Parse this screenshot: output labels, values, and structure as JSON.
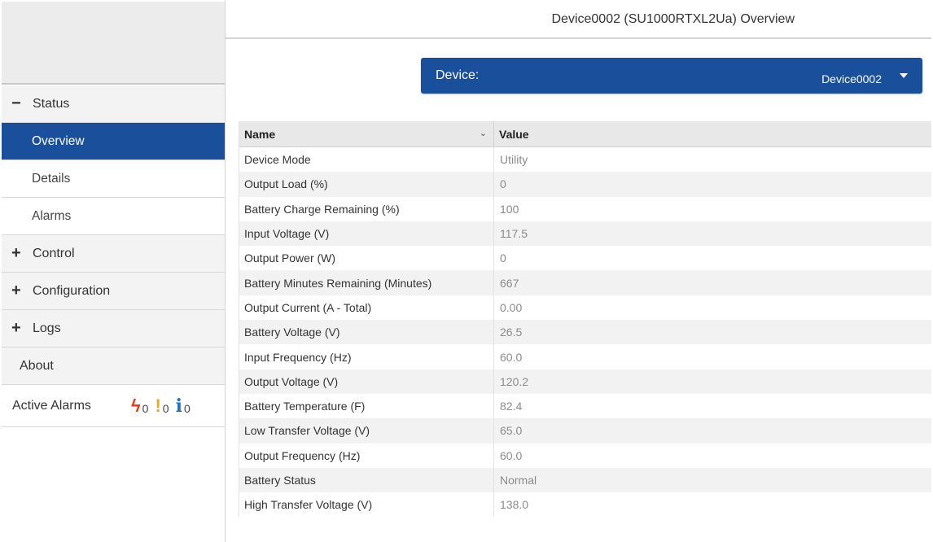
{
  "header": {
    "title": "Device0002 (SU1000RTXL2Ua) Overview"
  },
  "device_select": {
    "label": "Device:",
    "value": "Device0002"
  },
  "sidebar": {
    "status": {
      "sign": "−",
      "label": "Status"
    },
    "status_items": [
      {
        "label": "Overview"
      },
      {
        "label": "Details"
      },
      {
        "label": "Alarms"
      }
    ],
    "control": {
      "sign": "+",
      "label": "Control"
    },
    "configuration": {
      "sign": "+",
      "label": "Configuration"
    },
    "logs": {
      "sign": "+",
      "label": "Logs"
    },
    "about": {
      "label": "About"
    },
    "active_alarms": {
      "label": "Active Alarms",
      "critical_count": "0",
      "warning_count": "0",
      "info_count": "0"
    }
  },
  "table": {
    "columns": {
      "name": "Name",
      "value": "Value"
    },
    "rows": [
      {
        "name": "Device Mode",
        "value": "Utility"
      },
      {
        "name": "Output Load (%)",
        "value": "0"
      },
      {
        "name": "Battery Charge Remaining (%)",
        "value": "100"
      },
      {
        "name": "Input Voltage (V)",
        "value": "117.5"
      },
      {
        "name": "Output Power (W)",
        "value": "0"
      },
      {
        "name": "Battery Minutes Remaining (Minutes)",
        "value": "667"
      },
      {
        "name": "Output Current (A - Total)",
        "value": "0.00"
      },
      {
        "name": "Battery Voltage (V)",
        "value": "26.5"
      },
      {
        "name": "Input Frequency (Hz)",
        "value": "60.0"
      },
      {
        "name": "Output Voltage (V)",
        "value": "120.2"
      },
      {
        "name": "Battery Temperature (F)",
        "value": "82.4"
      },
      {
        "name": "Low Transfer Voltage (V)",
        "value": "65.0"
      },
      {
        "name": "Output Frequency (Hz)",
        "value": "60.0"
      },
      {
        "name": "Battery Status",
        "value": "Normal"
      },
      {
        "name": "High Transfer Voltage (V)",
        "value": "138.0"
      }
    ]
  },
  "icons": {
    "critical": "lightning-bolt-icon",
    "warning": "exclamation-icon",
    "info": "info-icon",
    "dropdown": "caret-down-icon",
    "sort": "chevron-down-icon"
  },
  "colors": {
    "accent": "#1a4f9c",
    "critical": "#e63a1e",
    "warning": "#f2a516",
    "info": "#1e72c7"
  }
}
